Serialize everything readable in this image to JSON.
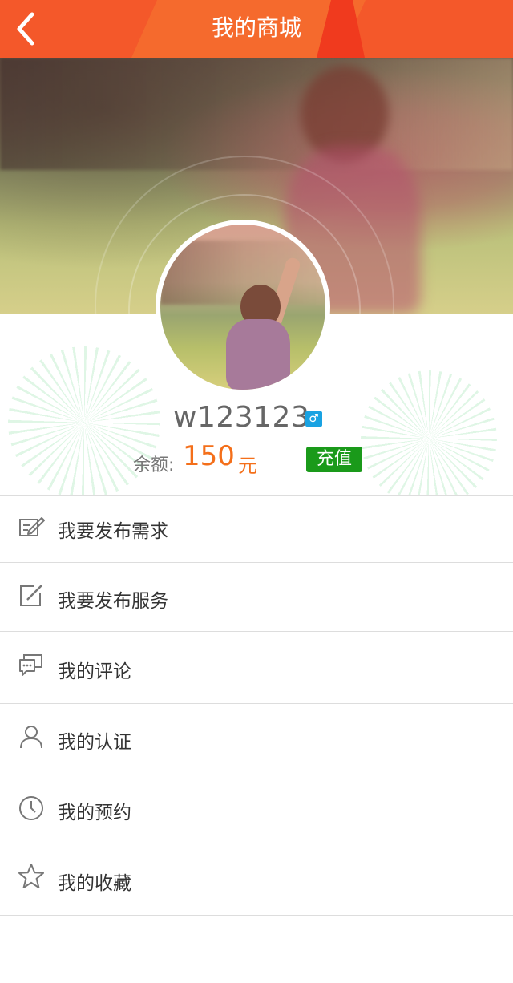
{
  "header": {
    "title": "我的商城",
    "back_icon": "chevron-left-icon"
  },
  "profile": {
    "username": "w123123",
    "gender_icon": "male-icon",
    "gender_symbol": "♂",
    "balance_label": "余额:",
    "balance_value": "150",
    "balance_unit": "元",
    "recharge_label": "充值"
  },
  "menu": {
    "items": [
      {
        "label": "我要发布需求",
        "icon": "edit-document-icon"
      },
      {
        "label": "我要发布服务",
        "icon": "edit-square-icon"
      },
      {
        "label": "我的评论",
        "icon": "comment-icon"
      },
      {
        "label": "我的认证",
        "icon": "user-icon"
      },
      {
        "label": "我的预约",
        "icon": "clock-icon"
      },
      {
        "label": "我的收藏",
        "icon": "star-icon"
      }
    ]
  },
  "colors": {
    "header_bg": "#f4582a",
    "accent_orange": "#f46f1a",
    "recharge_green": "#1a9a1a",
    "gender_blue": "#19a2e2"
  }
}
